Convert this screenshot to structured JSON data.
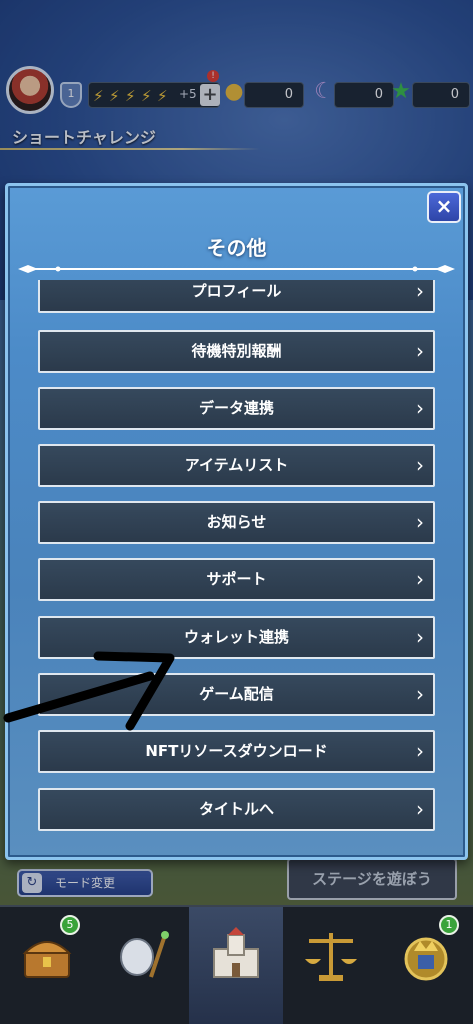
{
  "hud": {
    "level": "1",
    "stamina_bonus": "+5",
    "plus_label": "+",
    "alert": "!",
    "currency_1": "0",
    "currency_2": "0",
    "currency_3": "0"
  },
  "background": {
    "short_challenge": "ショートチャレンジ",
    "mode_change": "モード変更",
    "stage_button": "ステージを遊ぼう"
  },
  "modal": {
    "title": "その他",
    "close_label": "×",
    "items": [
      {
        "label": "プロフィール"
      },
      {
        "label": "待機特別報酬"
      },
      {
        "label": "データ連携"
      },
      {
        "label": "アイテムリスト"
      },
      {
        "label": "お知らせ"
      },
      {
        "label": "サポート"
      },
      {
        "label": "ウォレット連携"
      },
      {
        "label": "ゲーム配信"
      },
      {
        "label": "NFTリソースダウンロード"
      },
      {
        "label": "タイトルへ"
      }
    ]
  },
  "nav": {
    "items": [
      {
        "icon": "treasure-chest-icon",
        "badge": "5"
      },
      {
        "icon": "armor-weapon-icon",
        "badge": ""
      },
      {
        "icon": "castle-icon",
        "badge": "",
        "active": true
      },
      {
        "icon": "scales-icon",
        "badge": ""
      },
      {
        "icon": "crown-emblem-icon",
        "badge": "1"
      }
    ]
  },
  "colors": {
    "modal_bg": "#4c8bc8",
    "item_bg": "#2f3f51",
    "item_border": "#dfe7ef",
    "close_button": "#3a55c0",
    "nav_badge": "#3aa33a"
  }
}
